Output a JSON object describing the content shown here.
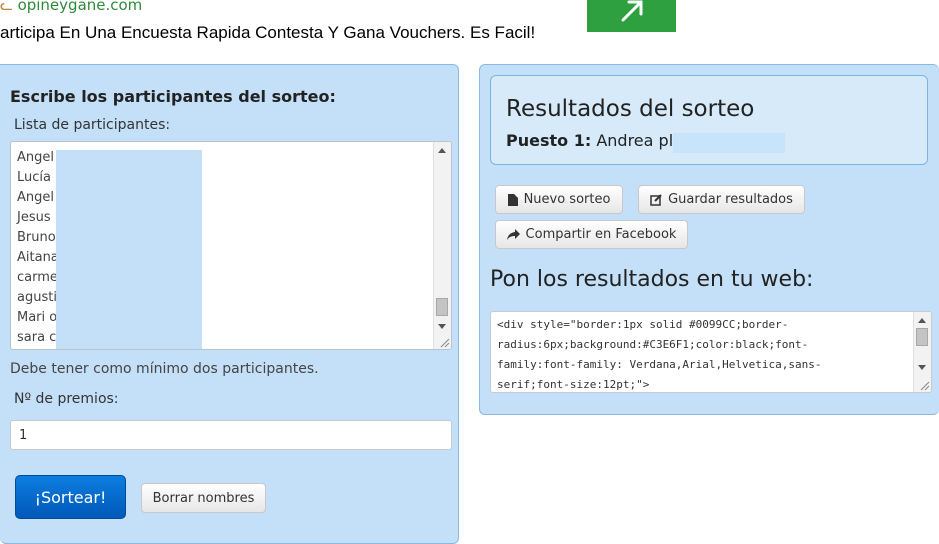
{
  "ad": {
    "domain": "opineygane.com",
    "headline": "articipa En Una Encuesta Rapida Contesta Y Gana Vouchers. Es Facil!",
    "button_icon": "arrow-icon"
  },
  "form": {
    "title": "Escribe los participantes del sorteo:",
    "list_label": "Lista de participantes:",
    "participants": [
      "Angel",
      "Lucía",
      "Angel",
      "Jesus",
      "Bruno",
      "Aitana",
      "carme",
      "agusti",
      "Mari o",
      "sara c"
    ],
    "min_hint": "Debe tener como mínimo dos participantes.",
    "prizes_label": "Nº de premios:",
    "prizes_value": "1",
    "draw_button": "¡Sortear!",
    "clear_button": "Borrar nombres"
  },
  "results": {
    "title": "Resultados del sorteo",
    "position_label": "Puesto 1:",
    "winner": "Andrea pl",
    "new_button": "Nuevo sorteo",
    "save_button": "Guardar resultados",
    "share_button": "Compartir en Facebook",
    "embed_title": "Pon los resultados en tu web:",
    "embed_code": [
      "<div style=\"border:1px solid #0099CC;border-",
      "radius:6px;background:#C3E6F1;color:black;font-",
      "family:font-family: Verdana,Arial,Helvetica,sans-",
      "serif;font-size:12pt;\">"
    ]
  },
  "colors": {
    "panel_bg": "#c3e0f8",
    "primary": "#0068c8",
    "ad_green": "#2ea040"
  }
}
